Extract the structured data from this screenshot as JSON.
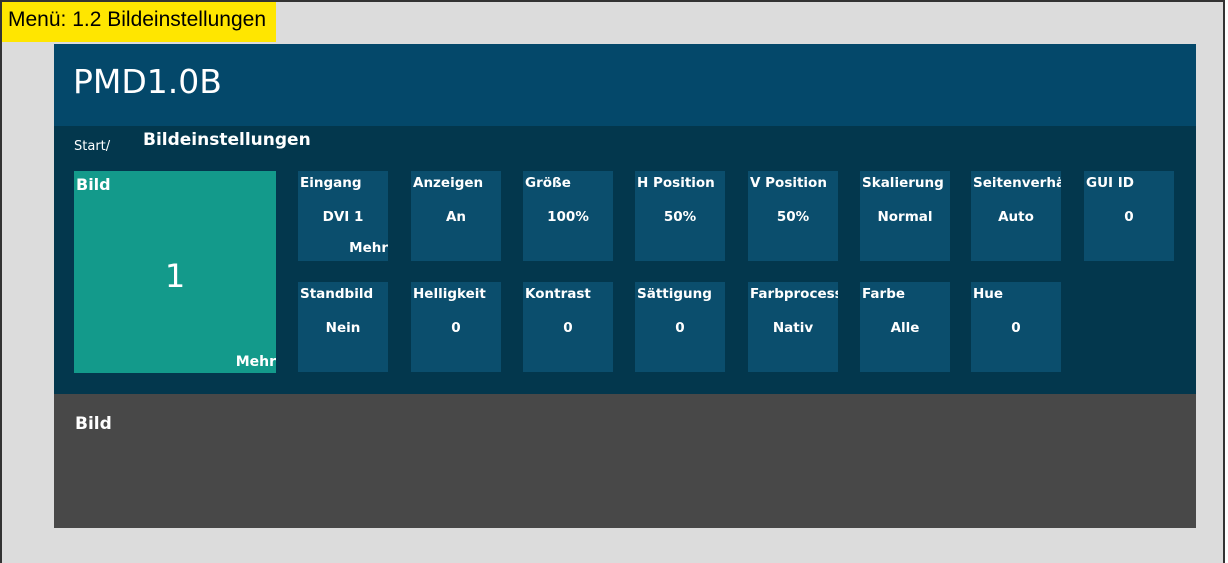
{
  "caption": "Menü: 1.2 Bildeinstellungen",
  "device_title": "PMD1.0B",
  "breadcrumb": {
    "start": "Start/",
    "current": "Bildeinstellungen"
  },
  "main_tile": {
    "label": "Bild",
    "value": "1",
    "more": "Mehr"
  },
  "settings_row1": [
    {
      "label": "Eingang",
      "value": "DVI 1",
      "more": "Mehr"
    },
    {
      "label": "Anzeigen",
      "value": "An"
    },
    {
      "label": "Größe",
      "value": "100%"
    },
    {
      "label": "H Position",
      "value": "50%"
    },
    {
      "label": "V Position",
      "value": "50%"
    },
    {
      "label": "Skalierung",
      "value": "Normal"
    },
    {
      "label": "Seitenverhä",
      "value": "Auto"
    },
    {
      "label": "GUI ID",
      "value": "0"
    }
  ],
  "settings_row2": [
    {
      "label": "Standbild",
      "value": "Nein"
    },
    {
      "label": "Helligkeit",
      "value": "0"
    },
    {
      "label": "Kontrast",
      "value": "0"
    },
    {
      "label": "Sättigung",
      "value": "0"
    },
    {
      "label": "Farbprocess",
      "value": "Nativ"
    },
    {
      "label": "Farbe",
      "value": "Alle"
    },
    {
      "label": "Hue",
      "value": "0"
    }
  ],
  "status_label": "Bild",
  "colors": {
    "caption_bg": "#ffe600",
    "header_bg": "#04486a",
    "panel_bg": "#03374d",
    "tile_bg": "#0b4e6d",
    "selected_tile_bg": "#139a8b",
    "status_bg": "#484848",
    "frame_bg": "#dcdcdc"
  }
}
